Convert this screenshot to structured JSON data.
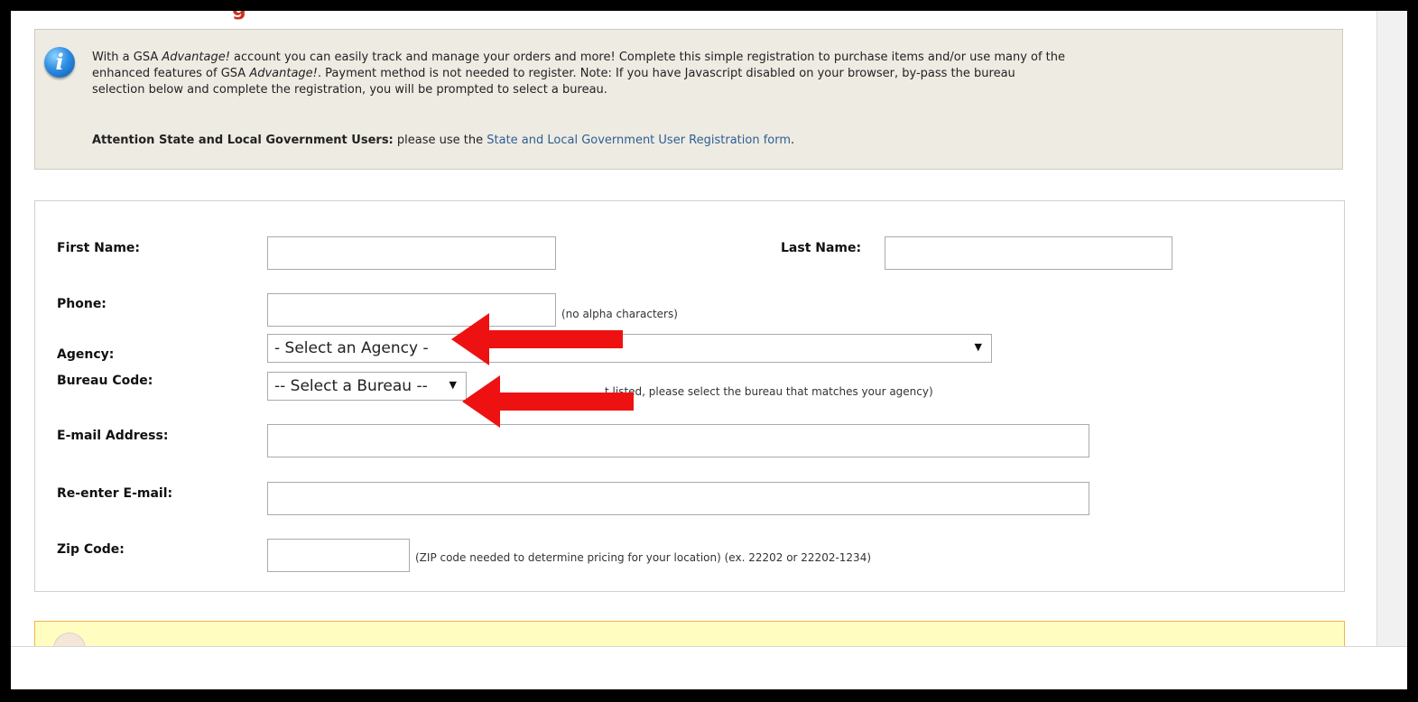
{
  "info": {
    "icon": "info-icon",
    "line1_a": "With a GSA ",
    "line1_em": "Advantage!",
    "line1_b": " account you can easily track and manage your orders and more! Complete this simple registration to purchase items and/or use many of the",
    "line2_a": "enhanced features of GSA ",
    "line2_em": "Advantage!",
    "line2_b": ". Payment method is not needed to register. Note: If you have Javascript disabled on your browser, by-pass the bureau",
    "line3": "selection below and complete the registration, you will be prompted to select a bureau.",
    "attention_bold": "Attention State and Local Government Users:",
    "attention_text": " please use the ",
    "attention_link": "State and Local Government User Registration form",
    "attention_end": "."
  },
  "form": {
    "first_name_label": "First Name:",
    "last_name_label": "Last Name:",
    "phone_label": "Phone:",
    "phone_hint": "(no alpha characters)",
    "agency_label": "Agency:",
    "agency_selected": "- Select an Agency -",
    "bureau_label": "Bureau Code:",
    "bureau_selected": "-- Select a Bureau --",
    "bureau_hint": "t listed, please select the bureau that matches your agency)",
    "email_label": "E-mail Address:",
    "reemail_label": "Re-enter E-mail:",
    "zip_label": "Zip Code:",
    "zip_hint": "(ZIP code needed to determine pricing for your location) (ex. 22202 or 22202-1234)"
  },
  "colors": {
    "arrow": "#ee1111",
    "info_bg": "#eeebe3",
    "yellow_bg": "#fffec0",
    "link": "#2d5f91"
  }
}
